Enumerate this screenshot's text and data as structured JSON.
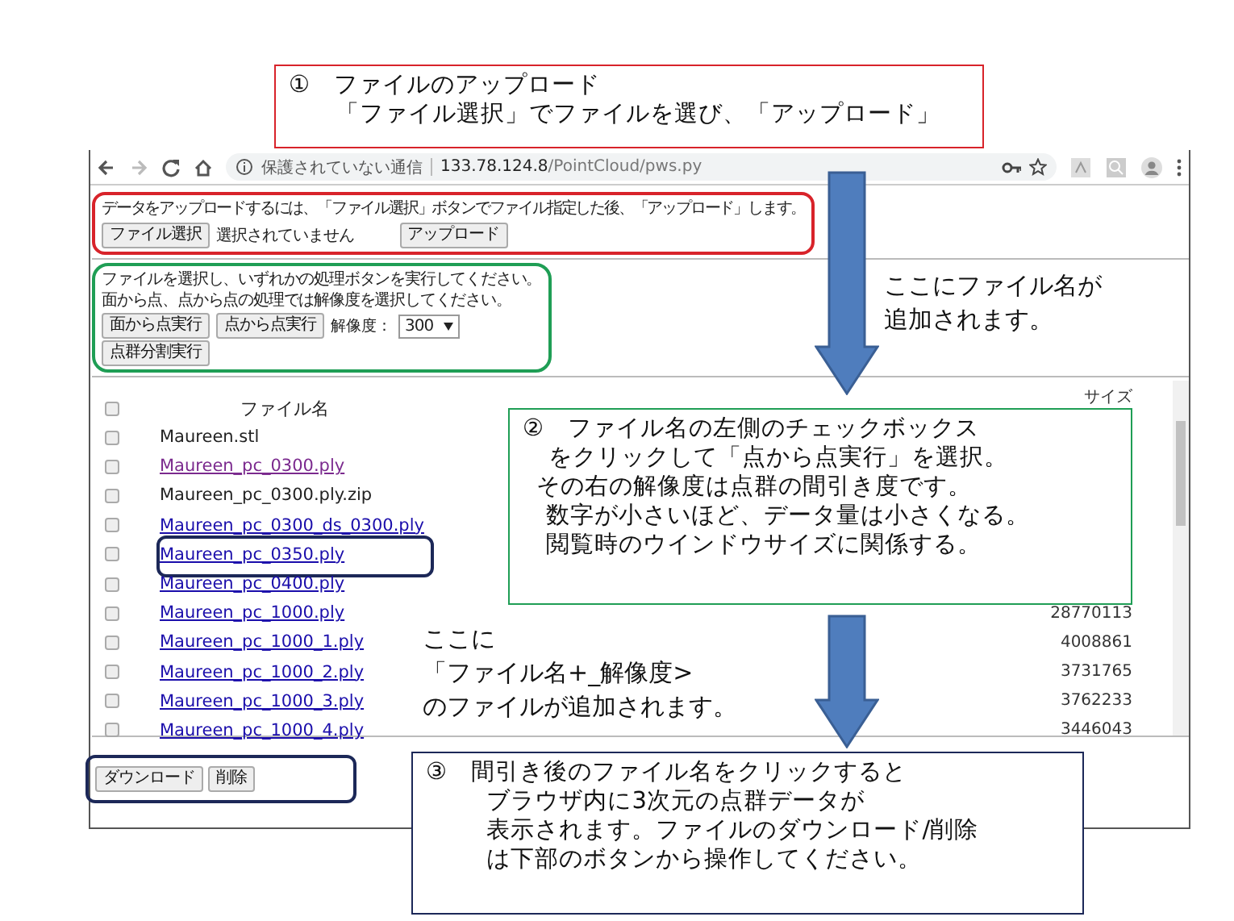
{
  "browser": {
    "security_label": "保護されていない通信",
    "url_host": "133.78.124.8",
    "url_path": "/PointCloud/pws.py"
  },
  "upload": {
    "instruction": "データをアップロードするには、「ファイル選択」ボタンでファイル指定した後、「アップロード」します。",
    "choose_button": "ファイル選択",
    "file_status": "選択されていません",
    "upload_button": "アップロード",
    "highlighted": true
  },
  "process": {
    "lines": [
      "ファイルを選択し、いずれかの処理ボタンを実行してください。",
      "面から点、点から点の処理では解像度を選択してください。"
    ],
    "buttons": [
      "面から点実行",
      "点から点実行"
    ],
    "resolution_label": "解像度：",
    "resolution": "300",
    "split_button": "点群分割実行",
    "highlighted": true
  },
  "table": {
    "columns": [
      "ファイル名",
      "サイズ"
    ],
    "header_checked": false,
    "rows": [
      {
        "name": "Maureen.stl",
        "kind": "plain",
        "checked": false,
        "highlighted": false
      },
      {
        "name": "Maureen_pc_0300.ply",
        "kind": "visited",
        "checked": false,
        "highlighted": false
      },
      {
        "name": "Maureen_pc_0300.ply.zip",
        "kind": "plain",
        "checked": false,
        "highlighted": false
      },
      {
        "name": "Maureen_pc_0300_ds_0300.ply",
        "kind": "link",
        "checked": false,
        "highlighted": false
      },
      {
        "name": "Maureen_pc_0350.ply",
        "kind": "link",
        "checked": false,
        "highlighted": true
      },
      {
        "name": "Maureen_pc_0400.ply",
        "kind": "link",
        "checked": false,
        "highlighted": false
      },
      {
        "name": "Maureen_pc_1000.ply",
        "kind": "link",
        "checked": false,
        "highlighted": false,
        "size": "28770113"
      },
      {
        "name": "Maureen_pc_1000_1.ply",
        "kind": "link",
        "checked": false,
        "highlighted": false,
        "size": "4008861"
      },
      {
        "name": "Maureen_pc_1000_2.ply",
        "kind": "link",
        "checked": false,
        "highlighted": false,
        "size": "3731765"
      },
      {
        "name": "Maureen_pc_1000_3.ply",
        "kind": "link",
        "checked": false,
        "highlighted": false,
        "size": "3762233"
      },
      {
        "name": "Maureen_pc_1000_4.ply",
        "kind": "link",
        "checked": false,
        "highlighted": false,
        "size": "3446043"
      }
    ]
  },
  "footer": {
    "buttons": [
      "ダウンロード",
      "削除"
    ],
    "highlighted": true
  },
  "callouts": [
    {
      "number": "①",
      "lines": [
        "ファイルのアップロード",
        "「ファイル選択」でファイルを選び、「アップロード」"
      ],
      "color": "#d8232a"
    },
    {
      "number": "②",
      "lines": [
        "ファイル名の左側のチェックボックス",
        "をクリックして「点から点実行」を選択。",
        "その右の解像度は点群の間引き度です。",
        "数字が小さいほど、データ量は小さくなる。",
        "閲覧時のウインドウサイズに関係する。"
      ],
      "color": "#1f9e55"
    },
    {
      "number": "③",
      "lines": [
        "間引き後のファイル名をクリックすると",
        "ブラウザ内に3次元の点群データが",
        "表示されます。ファイルのダウンロード/削除",
        "は下部のボタンから操作してください。"
      ],
      "color": "#1c2858"
    }
  ],
  "notes": [
    {
      "lines": [
        "ここにファイル名が",
        "追加されます。"
      ]
    },
    {
      "lines": [
        "ここに",
        "「ファイル名+_解像度>",
        "のファイルが追加されます。"
      ]
    }
  ]
}
